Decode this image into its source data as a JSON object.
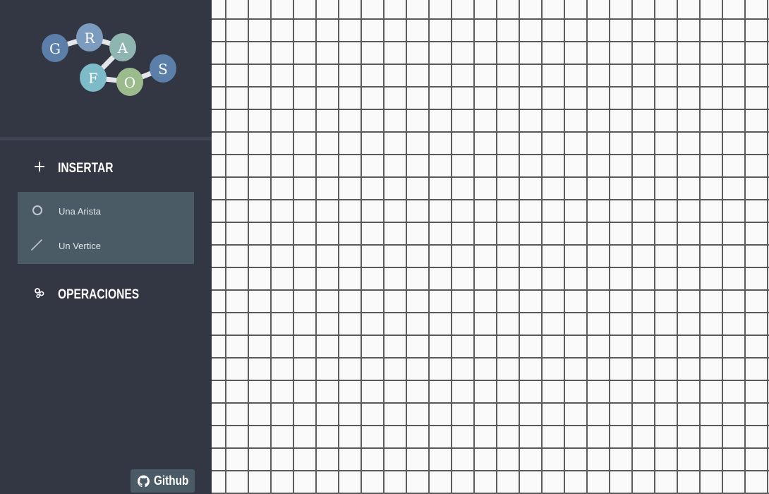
{
  "logo": {
    "letters": [
      "G",
      "R",
      "A",
      "F",
      "O",
      "S"
    ],
    "colors": {
      "G": "#5b7fa8",
      "R": "#7b9cbe",
      "A": "#8eb5b0",
      "F": "#7dbbc9",
      "O": "#9cbb8c",
      "S": "#5b7fa8"
    }
  },
  "sidebar": {
    "insert": {
      "icon": "plus-icon",
      "label": "INSERTAR",
      "items": [
        {
          "icon": "circle-icon",
          "label": "Una Arista"
        },
        {
          "icon": "line-icon",
          "label": "Un Vertice"
        }
      ]
    },
    "operations": {
      "icon": "gears-icon",
      "label": "OPERACIONES"
    },
    "github": {
      "icon": "github-icon",
      "label": "Github"
    }
  },
  "theme": {
    "sidebar_bg": "#333643",
    "submenu_bg": "#4b5b66",
    "canvas_bg": "#fafafa",
    "grid_line": "#5a5a5a"
  }
}
